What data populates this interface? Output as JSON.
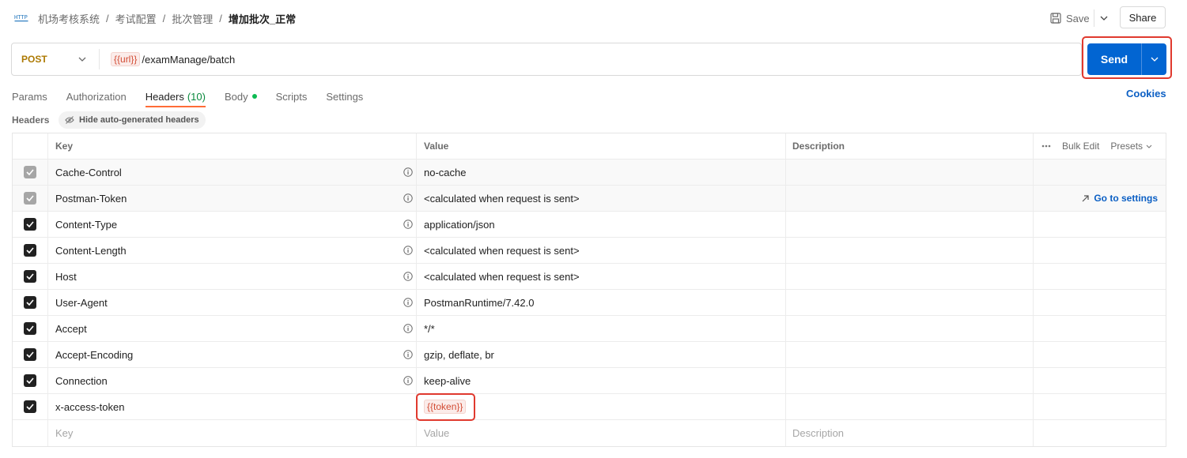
{
  "breadcrumb": {
    "items": [
      "机场考核系统",
      "考试配置",
      "批次管理"
    ],
    "current": "增加批次_正常",
    "separator": "/"
  },
  "toolbar": {
    "save_label": "Save",
    "share_label": "Share"
  },
  "request": {
    "method": "POST",
    "url_variable": "{{url}}",
    "url_path": "/examManage/batch",
    "send_label": "Send"
  },
  "tabs": [
    {
      "label": "Params"
    },
    {
      "label": "Authorization"
    },
    {
      "label": "Headers",
      "count": "(10)",
      "active": true
    },
    {
      "label": "Body",
      "has_dot": true
    },
    {
      "label": "Scripts"
    },
    {
      "label": "Settings"
    }
  ],
  "cookies_label": "Cookies",
  "headers_section": {
    "label": "Headers",
    "hide_auto_label": "Hide auto-generated headers"
  },
  "table": {
    "columns": {
      "key": "Key",
      "value": "Value",
      "description": "Description"
    },
    "bulk_edit_label": "Bulk Edit",
    "presets_label": "Presets",
    "go_to_settings_label": "Go to settings",
    "rows": [
      {
        "key": "Cache-Control",
        "value": "no-cache",
        "checked": "grey"
      },
      {
        "key": "Postman-Token",
        "value": "<calculated when request is sent>",
        "checked": "grey"
      },
      {
        "key": "Content-Type",
        "value": "application/json",
        "checked": "on"
      },
      {
        "key": "Content-Length",
        "value": "<calculated when request is sent>",
        "checked": "on"
      },
      {
        "key": "Host",
        "value": "<calculated when request is sent>",
        "checked": "on"
      },
      {
        "key": "User-Agent",
        "value": "PostmanRuntime/7.42.0",
        "checked": "on"
      },
      {
        "key": "Accept",
        "value": "*/*",
        "checked": "on"
      },
      {
        "key": "Accept-Encoding",
        "value": "gzip, deflate, br",
        "checked": "on"
      },
      {
        "key": "Connection",
        "value": "keep-alive",
        "checked": "on"
      },
      {
        "key": "x-access-token",
        "value": "{{token}}",
        "checked": "on"
      }
    ],
    "placeholder": {
      "key": "Key",
      "value": "Value",
      "description": "Description"
    }
  },
  "colors": {
    "send_button": "#0265d2",
    "method_post": "#ad7a03",
    "highlight_box": "#e0392e",
    "active_tab_underline": "#ff6c37",
    "link": "#0b5fc4"
  }
}
